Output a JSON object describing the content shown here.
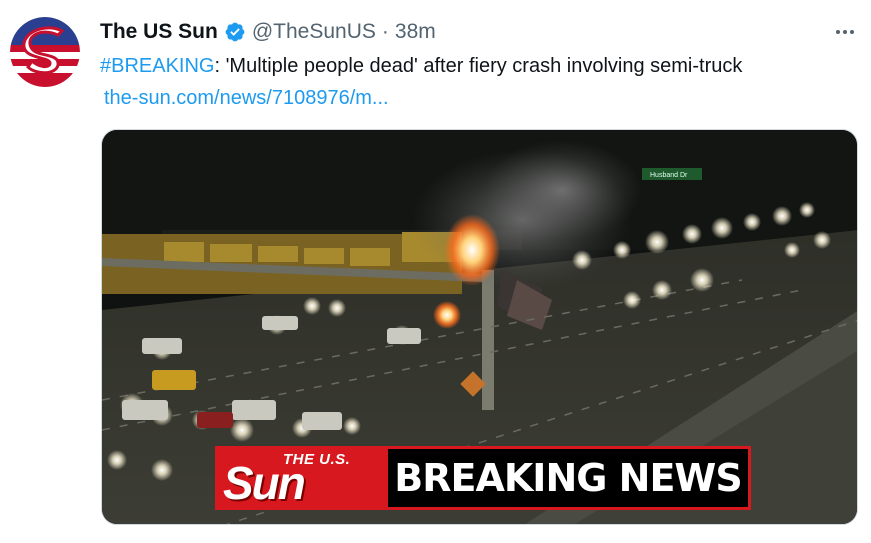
{
  "tweet": {
    "display_name": "The US Sun",
    "handle": "@TheSunUS",
    "separator": "·",
    "time": "38m",
    "hashtag": "#BREAKING",
    "text": ": 'Multiple people dead' after fiery crash involving semi-truck",
    "link": "the-sun.com/news/7108976/m..."
  },
  "media": {
    "banner_logo_small": "THE U.S.",
    "banner_logo_big": "Sun",
    "banner_text": "BREAKING NEWS",
    "sign_text": "Husband Dr"
  },
  "icons": {
    "verified": "verified-badge-icon",
    "more": "more-options-icon"
  },
  "colors": {
    "accent": "#1d9bf0",
    "secondary_text": "#536471",
    "banner_red": "#d7191f"
  }
}
